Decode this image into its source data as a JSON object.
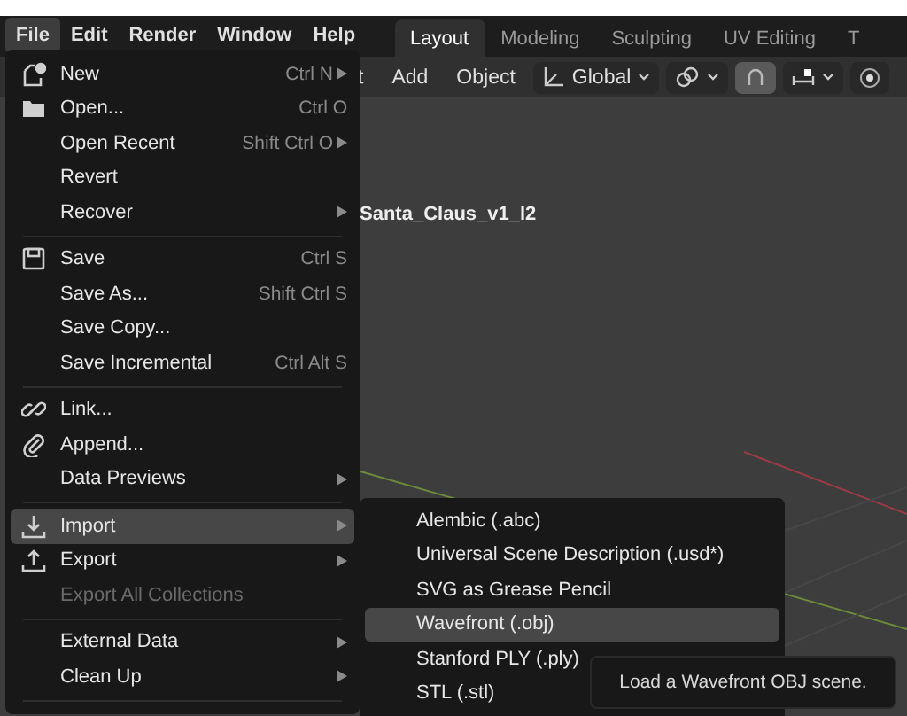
{
  "menubar": [
    {
      "label": "File",
      "selected": true
    },
    {
      "label": "Edit",
      "selected": false
    },
    {
      "label": "Render",
      "selected": false
    },
    {
      "label": "Window",
      "selected": false
    },
    {
      "label": "Help",
      "selected": false
    }
  ],
  "workspace_tabs": [
    {
      "label": "Layout",
      "selected": true
    },
    {
      "label": "Modeling",
      "selected": false
    },
    {
      "label": "Sculpting",
      "selected": false
    },
    {
      "label": "UV Editing",
      "selected": false
    },
    {
      "label": "T",
      "selected": false
    }
  ],
  "toolbar": {
    "menus": [
      "t",
      "Add",
      "Object"
    ],
    "orientation": "Global",
    "snap_on": true
  },
  "viewport": {
    "object_name": "Santa_Claus_v1_l2"
  },
  "file_menu": [
    {
      "kind": "item",
      "label": "New",
      "shortcut": "Ctrl N",
      "submenu": true,
      "selected": false,
      "disabled": false
    },
    {
      "kind": "item",
      "label": "Open...",
      "shortcut": "Ctrl O",
      "submenu": false,
      "selected": false,
      "disabled": false
    },
    {
      "kind": "item",
      "label": "Open Recent",
      "shortcut": "Shift Ctrl O",
      "submenu": true,
      "selected": false,
      "disabled": false
    },
    {
      "kind": "item",
      "label": "Revert",
      "submenu": false,
      "selected": false,
      "disabled": false
    },
    {
      "kind": "item",
      "label": "Recover",
      "submenu": true,
      "selected": false,
      "disabled": false
    },
    {
      "kind": "separator"
    },
    {
      "kind": "item",
      "label": "Save",
      "shortcut": "Ctrl S",
      "submenu": false,
      "selected": false,
      "disabled": false
    },
    {
      "kind": "item",
      "label": "Save As...",
      "shortcut": "Shift Ctrl S",
      "submenu": false,
      "selected": false,
      "disabled": false
    },
    {
      "kind": "item",
      "label": "Save Copy...",
      "submenu": false,
      "selected": false,
      "disabled": false
    },
    {
      "kind": "item",
      "label": "Save Incremental",
      "shortcut": "Ctrl Alt S",
      "submenu": false,
      "selected": false,
      "disabled": false
    },
    {
      "kind": "separator"
    },
    {
      "kind": "item",
      "label": "Link...",
      "submenu": false,
      "selected": false,
      "disabled": false
    },
    {
      "kind": "item",
      "label": "Append...",
      "submenu": false,
      "selected": false,
      "disabled": false
    },
    {
      "kind": "item",
      "label": "Data Previews",
      "submenu": true,
      "selected": false,
      "disabled": false
    },
    {
      "kind": "separator"
    },
    {
      "kind": "item",
      "label": "Import",
      "submenu": true,
      "selected": true,
      "disabled": false
    },
    {
      "kind": "item",
      "label": "Export",
      "submenu": true,
      "selected": false,
      "disabled": false
    },
    {
      "kind": "item",
      "label": "Export All Collections",
      "submenu": false,
      "selected": false,
      "disabled": true
    },
    {
      "kind": "separator"
    },
    {
      "kind": "item",
      "label": "External Data",
      "submenu": true,
      "selected": false,
      "disabled": false
    },
    {
      "kind": "item",
      "label": "Clean Up",
      "submenu": true,
      "selected": false,
      "disabled": false
    },
    {
      "kind": "separator"
    }
  ],
  "import_submenu": [
    {
      "label": "Alembic (.abc)",
      "selected": false
    },
    {
      "label": "Universal Scene Description (.usd*)",
      "selected": false
    },
    {
      "label": "SVG as Grease Pencil",
      "selected": false
    },
    {
      "label": "Wavefront (.obj)",
      "selected": true
    },
    {
      "label": "Stanford PLY (.ply)",
      "selected": false
    },
    {
      "label": "STL (.stl)",
      "selected": false
    }
  ],
  "tooltip": "Load a Wavefront OBJ scene."
}
